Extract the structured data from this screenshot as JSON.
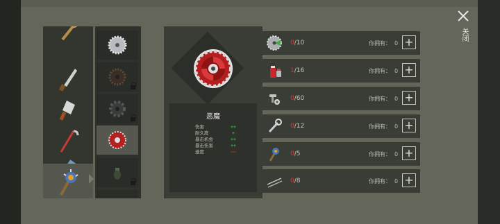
{
  "close": {
    "label": "关闭",
    "icon": "close-icon"
  },
  "weapons": [
    {
      "icon": "wrench-icon",
      "selected": false
    },
    {
      "icon": "machete-icon",
      "selected": false
    },
    {
      "icon": "cleaver-icon",
      "selected": false
    },
    {
      "icon": "crowbar-icon",
      "selected": false
    },
    {
      "icon": "sledgehammer-icon",
      "selected": false
    },
    {
      "icon": "spiked-mace-icon",
      "selected": true
    }
  ],
  "mods": [
    {
      "icon": "saw-blade-silver-icon",
      "locked": false,
      "selected": false
    },
    {
      "icon": "saw-blade-dark-icon",
      "locked": true,
      "selected": false
    },
    {
      "icon": "gear-blade-icon",
      "locked": true,
      "selected": false
    },
    {
      "icon": "saw-blade-red-icon",
      "locked": false,
      "selected": true
    },
    {
      "icon": "grenade-icon",
      "locked": true,
      "selected": false
    }
  ],
  "detail": {
    "icon": "saw-blade-red-icon",
    "name": "恶魔",
    "stats": [
      {
        "label": "伤害",
        "value": "++",
        "color": "#3fbf3f"
      },
      {
        "label": "耐久度",
        "value": "+",
        "color": "#3fbf3f"
      },
      {
        "label": "暴击机会",
        "value": "++",
        "color": "#3fbf3f"
      },
      {
        "label": "暴击伤害",
        "value": "++",
        "color": "#3fbf3f"
      },
      {
        "label": "速度",
        "value": "−−",
        "color": "#d63a2f"
      }
    ]
  },
  "requirements": [
    {
      "icon": "saw-blade-icon",
      "current": "0",
      "total": "/10",
      "own_label": "你拥有：",
      "own_value": "0",
      "add_label": "+"
    },
    {
      "icon": "spray-can-icon",
      "current": "1",
      "total": "/16",
      "own_label": "你拥有：",
      "own_value": "0",
      "add_label": "+"
    },
    {
      "icon": "bolts-icon",
      "current": "0",
      "total": "/60",
      "own_label": "你拥有：",
      "own_value": "0",
      "add_label": "+"
    },
    {
      "icon": "wrench-icon",
      "current": "0",
      "total": "/12",
      "own_label": "你拥有：",
      "own_value": "0",
      "add_label": "+"
    },
    {
      "icon": "spiked-mace-icon",
      "current": "0",
      "total": "/5",
      "own_label": "你拥有：",
      "own_value": "0",
      "add_label": "+"
    },
    {
      "icon": "needles-icon",
      "current": "0",
      "total": "/8",
      "own_label": "你拥有：",
      "own_value": "0",
      "add_label": "+"
    }
  ]
}
